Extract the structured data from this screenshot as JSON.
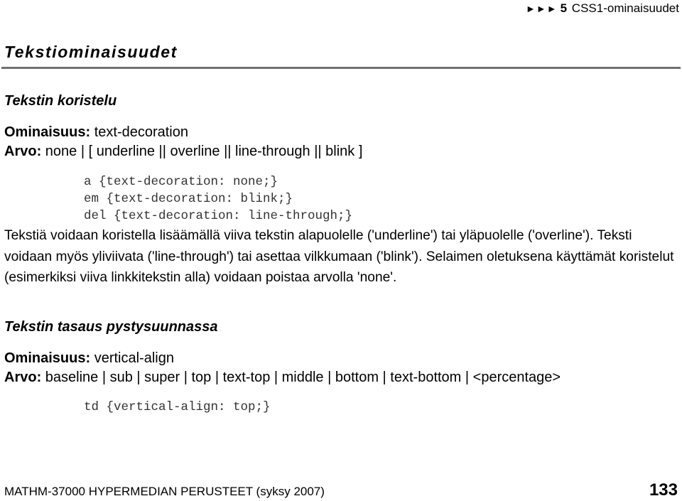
{
  "header": {
    "arrows": "►►►",
    "chapter_number": "5",
    "chapter_title": "CSS1-ominaisuudet"
  },
  "page_title": "Tekstiominaisuudet",
  "sections": [
    {
      "heading": "Tekstin koristelu",
      "property_label": "Ominaisuus:",
      "property_value": "text-decoration",
      "values_label": "Arvo:",
      "values_value": "none | [ underline || overline || line-through || blink ]",
      "code_lines": [
        "a {text-decoration: none;}",
        "em {text-decoration: blink;}",
        "del {text-decoration: line-through;}"
      ],
      "paragraph": "Tekstiä voidaan koristella lisäämällä viiva tekstin alapuolelle ('underline') tai yläpuolelle ('overline'). Teksti voidaan myös yliviivata ('line-through') tai asettaa vilkkumaan ('blink'). Selaimen oletuksena käyttämät koristelut (esimerkiksi viiva linkkitekstin alla) voidaan poistaa arvolla 'none'."
    },
    {
      "heading": "Tekstin tasaus pystysuunnassa",
      "property_label": "Ominaisuus:",
      "property_value": "vertical-align",
      "values_label": "Arvo:",
      "values_value": "baseline | sub | super | top | text-top | middle | bottom | text-bottom | <percentage>",
      "code_lines": [
        "td {vertical-align: top;}"
      ]
    }
  ],
  "footer": {
    "course": "MATHM-37000 HYPERMEDIAN PERUSTEET (syksy 2007)",
    "page_number": "133"
  }
}
